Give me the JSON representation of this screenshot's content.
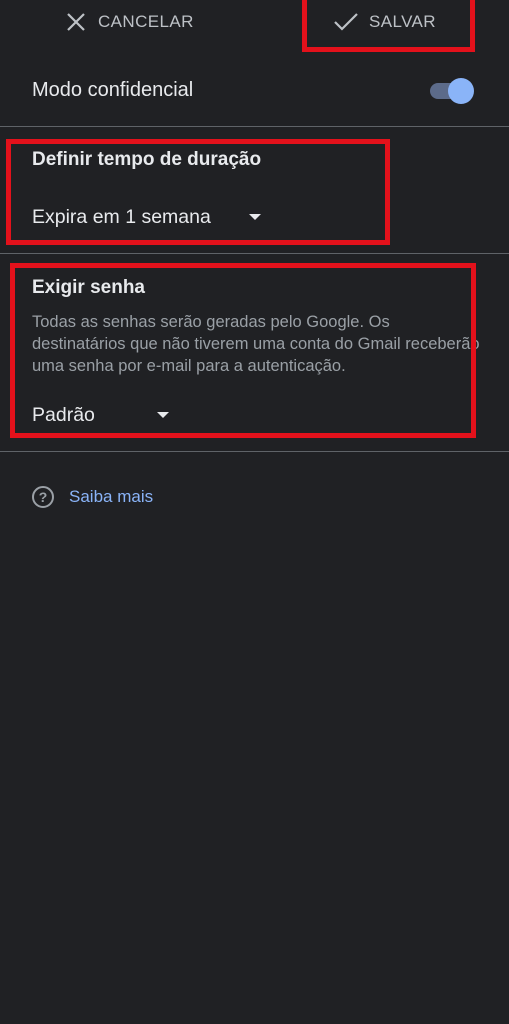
{
  "toolbar": {
    "cancel_label": "CANCELAR",
    "save_label": "SALVAR"
  },
  "confidential_mode": {
    "label": "Modo confidencial",
    "enabled": true
  },
  "expiration": {
    "title": "Definir tempo de duração",
    "selected": "Expira em 1 semana"
  },
  "password": {
    "title": "Exigir senha",
    "description": "Todas as senhas serão geradas pelo Google. Os destinatários que não tiverem uma conta do Gmail receberão uma senha por e-mail para a autenticação.",
    "selected": "Padrão"
  },
  "help": {
    "link_label": "Saiba mais"
  },
  "colors": {
    "background": "#202124",
    "accent": "#8ab4f8",
    "highlight": "#e3111b"
  }
}
